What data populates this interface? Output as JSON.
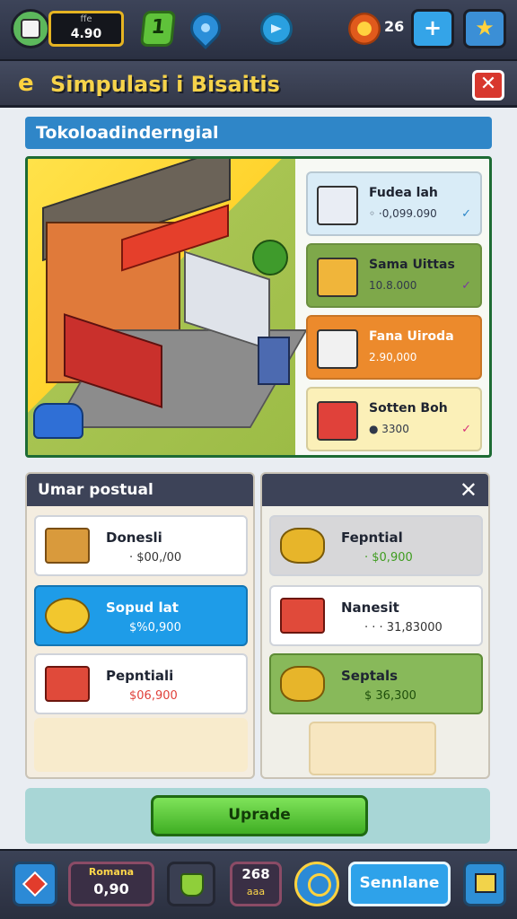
{
  "hud": {
    "money_label": "ffe",
    "money_value": "4.90",
    "level": "1",
    "gear_count": "26",
    "plus_label": "+",
    "star_label": "★"
  },
  "window": {
    "title": "Simpulasi i Bisaitis",
    "close_label": "✕",
    "subtitle": "Tokoloadinderngial"
  },
  "shop_items": [
    {
      "name": "Fudea lah",
      "price": "◦ ·0,099.090",
      "chevron": "✓",
      "bg": "#d9ecf7",
      "thumb": "#e9edf4",
      "chev_color": "#2b86c8"
    },
    {
      "name": "Sama Uittas",
      "price": "10.8.000",
      "chevron": "✓",
      "bg": "#7ea84a",
      "thumb": "#f0b53a",
      "chev_color": "#7a3aa0"
    },
    {
      "name": "Fana Uiroda",
      "price": "2.90,000",
      "chevron": "",
      "bg": "#ec8a2c",
      "thumb": "#f1f1f1",
      "chev_color": "#ffffff"
    },
    {
      "name": "Sotten Boh",
      "price": "● 3300",
      "chevron": "✓",
      "bg": "#fbf0b8",
      "thumb": "#e0413a",
      "chev_color": "#d6307a"
    }
  ],
  "left_panel": {
    "title": "Umar postual",
    "rows": [
      {
        "name": "Donesli",
        "price": "· $00,/00"
      },
      {
        "name": "Sopud lat",
        "price": "$%0,900"
      },
      {
        "name": "Pepntiali",
        "price": "$06,900"
      }
    ]
  },
  "right_panel": {
    "close_label": "✕",
    "rows": [
      {
        "name": "Fepntial",
        "price": "· $0,900"
      },
      {
        "name": "Nanesit",
        "price": "· · · 31,83000"
      },
      {
        "name": "Septals",
        "price": "$ 36,300"
      }
    ],
    "placeholder": ""
  },
  "upgrade": {
    "label": "Uprade"
  },
  "bottom": {
    "money_label": "Romana",
    "money_value": "0,90",
    "count_value": "268",
    "count_label": "aaa",
    "seminar_label": "Sennlane"
  }
}
